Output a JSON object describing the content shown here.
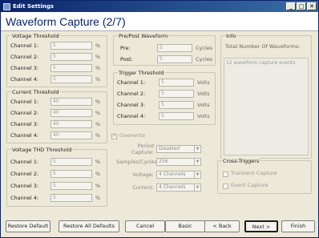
{
  "window": {
    "title": "Edit Settings",
    "min": "_",
    "max": "□",
    "close": "✕"
  },
  "header": {
    "title": "Waveform Capture (2/7)"
  },
  "voltage_threshold": {
    "title": "Voltage Threshold",
    "unit": "%",
    "channels": [
      {
        "label": "Channel 1:",
        "value": "5"
      },
      {
        "label": "Channel 2:",
        "value": "5"
      },
      {
        "label": "Channel 3:",
        "value": "5"
      },
      {
        "label": "Channel 4:",
        "value": "5"
      }
    ]
  },
  "current_threshold": {
    "title": "Current Threshold",
    "unit": "%",
    "channels": [
      {
        "label": "Channel 1:",
        "value": "40"
      },
      {
        "label": "Channel 2:",
        "value": "40"
      },
      {
        "label": "Channel 3:",
        "value": "40"
      },
      {
        "label": "Channel 4:",
        "value": "40"
      }
    ]
  },
  "voltage_thd_threshold": {
    "title": "Voltage THD Threshold",
    "unit": "%",
    "channels": [
      {
        "label": "Channel 1:",
        "value": "5"
      },
      {
        "label": "Channel 2:",
        "value": "5"
      },
      {
        "label": "Channel 3:",
        "value": "5"
      },
      {
        "label": "Channel 4:",
        "value": "5"
      }
    ]
  },
  "pre_post": {
    "title": "Pre/Post Waveform",
    "unit": "Cycles",
    "rows": [
      {
        "label": "Pre:",
        "value": "5"
      },
      {
        "label": "Post:",
        "value": "5"
      }
    ]
  },
  "trigger_threshold": {
    "title": "Trigger Threshold",
    "unit": "Volts",
    "channels": [
      {
        "label": "Channel 1:",
        "value": "5"
      },
      {
        "label": "Channel 2:",
        "value": "5"
      },
      {
        "label": "Channel 3:",
        "value": "5"
      },
      {
        "label": "Channel 4:",
        "value": "5"
      }
    ]
  },
  "info": {
    "title": "Info",
    "total_label": "Total Number Of Waveforms:",
    "events_text": "12 waveform capture events"
  },
  "overwrite": {
    "label": "Overwrite",
    "checked": true
  },
  "settings": {
    "period_capture": {
      "label": "Period Capture:",
      "value": "Disabled"
    },
    "samples_cycles": {
      "label": "Samples/Cycles:",
      "value": "256"
    },
    "voltage": {
      "label": "Voltage:",
      "value": "4 Channels"
    },
    "current": {
      "label": "Current:",
      "value": "4 Channels"
    }
  },
  "cross_triggers": {
    "title": "Cross-Triggers",
    "transient": "Transient Capture",
    "event": "Event Capture"
  },
  "buttons": {
    "restore_default": "Restore Default",
    "restore_all": "Restore All Defaults",
    "cancel": "Cancel",
    "basic": "Basic",
    "back": "< Back",
    "next": "Next >",
    "finish": "Finish"
  }
}
